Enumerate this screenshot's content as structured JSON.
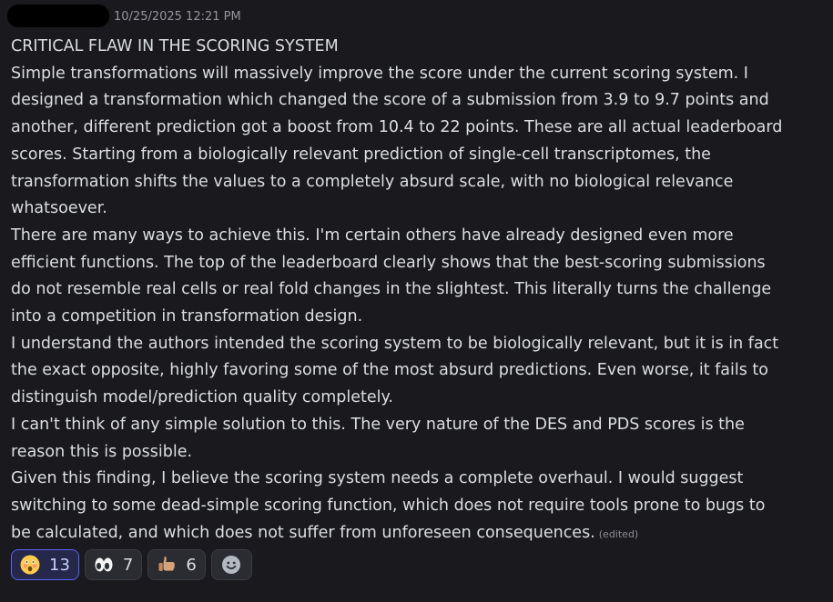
{
  "header": {
    "timestamp": "10/25/2025 12:21 PM"
  },
  "message": {
    "lines": [
      "CRITICAL FLAW IN THE SCORING SYSTEM",
      "Simple transformations will massively improve the score under the current scoring system. I",
      "designed a transformation which changed the score of a submission from 3.9 to 9.7 points and",
      "another, different prediction got a boost from 10.4 to 22 points. These are all actual leaderboard",
      "scores. Starting from a biologically relevant prediction of single-cell transcriptomes, the",
      "transformation shifts the values to a completely absurd scale, with no biological relevance",
      "whatsoever.",
      "There are many ways to achieve this. I'm certain others have already designed even more",
      "efficient functions. The top of the leaderboard clearly shows that the best-scoring submissions",
      "do not resemble real cells or real fold changes in the slightest. This literally turns the challenge",
      "into a competition in transformation design.",
      "I understand the authors intended the scoring system to be biologically relevant, but it is in fact",
      "the exact opposite, highly favoring some of the most absurd predictions. Even worse, it fails to",
      "distinguish model/prediction quality completely.",
      "I can't think of any simple solution to this. The very nature of the DES and PDS scores is the",
      "reason this is possible.",
      "Given this finding, I believe the scoring system needs a complete overhaul. I would suggest",
      "switching to some dead-simple scoring function, which does not require tools prone to bugs to",
      "be calculated, and which does not suffer from unforeseen consequences."
    ],
    "edited_label": "(edited)"
  },
  "reactions": [
    {
      "icon": "astonished-face-icon",
      "count": "13",
      "active": true
    },
    {
      "icon": "eyes-icon",
      "count": "7",
      "active": false
    },
    {
      "icon": "thumbs-up-icon",
      "count": "6",
      "active": false
    }
  ],
  "add_reaction_icon": "add-reaction-icon",
  "colors": {
    "background": "#1a1a1e",
    "text": "#dbdee1",
    "muted": "#94959c",
    "accent": "#5865f2"
  }
}
